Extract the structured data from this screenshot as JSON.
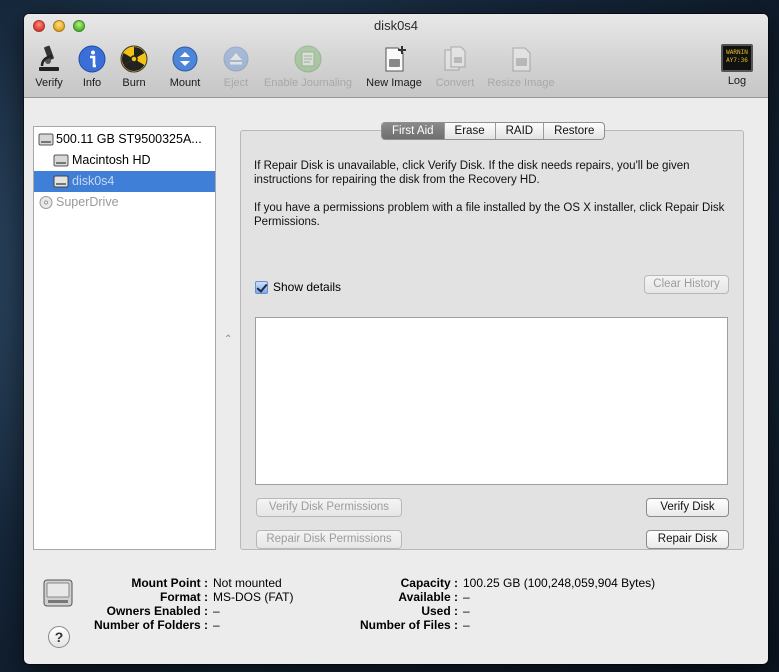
{
  "window": {
    "title": "disk0s4"
  },
  "toolbar": {
    "verify": "Verify",
    "info": "Info",
    "burn": "Burn",
    "mount": "Mount",
    "eject": "Eject",
    "enable_journaling": "Enable Journaling",
    "new_image": "New Image",
    "convert": "Convert",
    "resize_image": "Resize Image",
    "log": "Log",
    "log_screen_text": "WARNIN AY7:36"
  },
  "sidebar": {
    "items": [
      {
        "label": "500.11 GB ST9500325A..."
      },
      {
        "label": "Macintosh HD"
      },
      {
        "label": "disk0s4"
      },
      {
        "label": "SuperDrive"
      }
    ]
  },
  "tabs": [
    "First Aid",
    "Erase",
    "RAID",
    "Restore"
  ],
  "first_aid": {
    "para1": "If Repair Disk is unavailable, click Verify Disk. If the disk needs repairs, you'll be given instructions for repairing the disk from the Recovery HD.",
    "para2": "If you have a permissions problem with a file installed by the OS X installer, click Repair Disk Permissions.",
    "show_details": "Show details",
    "clear_history": "Clear History",
    "verify_perms": "Verify Disk Permissions",
    "verify_disk": "Verify Disk",
    "repair_perms": "Repair Disk Permissions",
    "repair_disk": "Repair Disk"
  },
  "info": {
    "mount_point_k": "Mount Point :",
    "mount_point_v": "Not mounted",
    "format_k": "Format :",
    "format_v": "MS-DOS (FAT)",
    "owners_k": "Owners Enabled :",
    "owners_v": "–",
    "folders_k": "Number of Folders :",
    "folders_v": "–",
    "capacity_k": "Capacity :",
    "capacity_v": "100.25 GB (100,248,059,904 Bytes)",
    "available_k": "Available :",
    "available_v": "–",
    "used_k": "Used :",
    "used_v": "–",
    "files_k": "Number of Files :",
    "files_v": "–"
  },
  "help_glyph": "?",
  "colors": {
    "selection": "#3f7fd7",
    "tab_active": "#7a7a7a"
  }
}
